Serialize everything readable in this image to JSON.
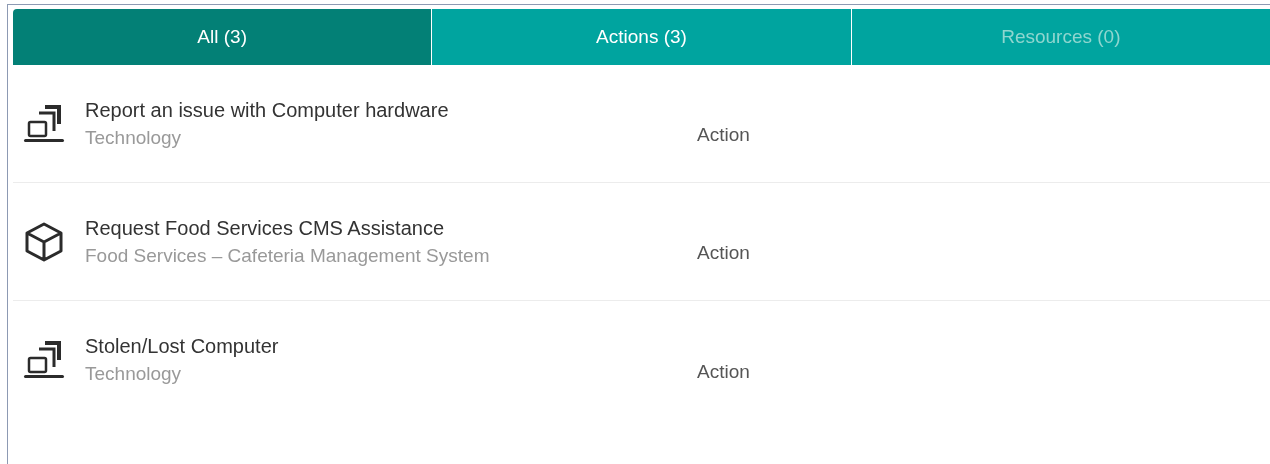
{
  "tabs": [
    {
      "label": "All (3)",
      "selected": true,
      "disabled": false
    },
    {
      "label": "Actions (3)",
      "selected": false,
      "disabled": false
    },
    {
      "label": "Resources (0)",
      "selected": false,
      "disabled": true
    }
  ],
  "items": [
    {
      "kind": "computer",
      "title": "Report an issue with Computer hardware",
      "category": "Technology",
      "type": "Action"
    },
    {
      "kind": "cube",
      "title": "Request Food Services CMS Assistance",
      "category": "Food Services – Cafeteria Management System",
      "type": "Action"
    },
    {
      "kind": "computer",
      "title": "Stolen/Lost Computer",
      "category": "Technology",
      "type": "Action"
    }
  ]
}
